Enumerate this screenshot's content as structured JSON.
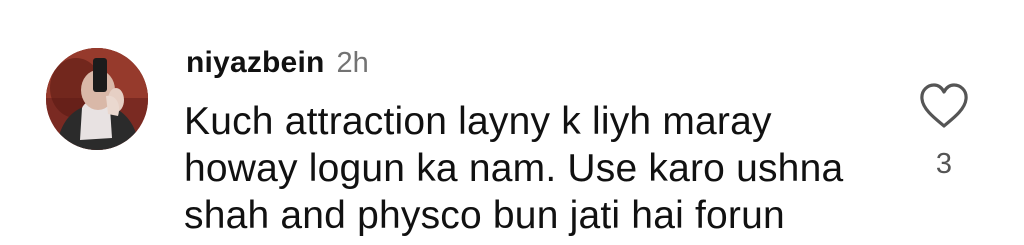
{
  "comment": {
    "username": "niyazbein",
    "time": "2h",
    "lines": [
      "Kuch attraction layny k liyh maray",
      "howay logun ka nam. Use karo ushna",
      "shah and physco bun jati hai forun"
    ],
    "like_count": "3",
    "like_icon": "heart-outline-icon",
    "avatar_icon": "user-avatar-photo"
  },
  "colors": {
    "text": "#111111",
    "muted": "#737373",
    "icon": "#555555"
  }
}
